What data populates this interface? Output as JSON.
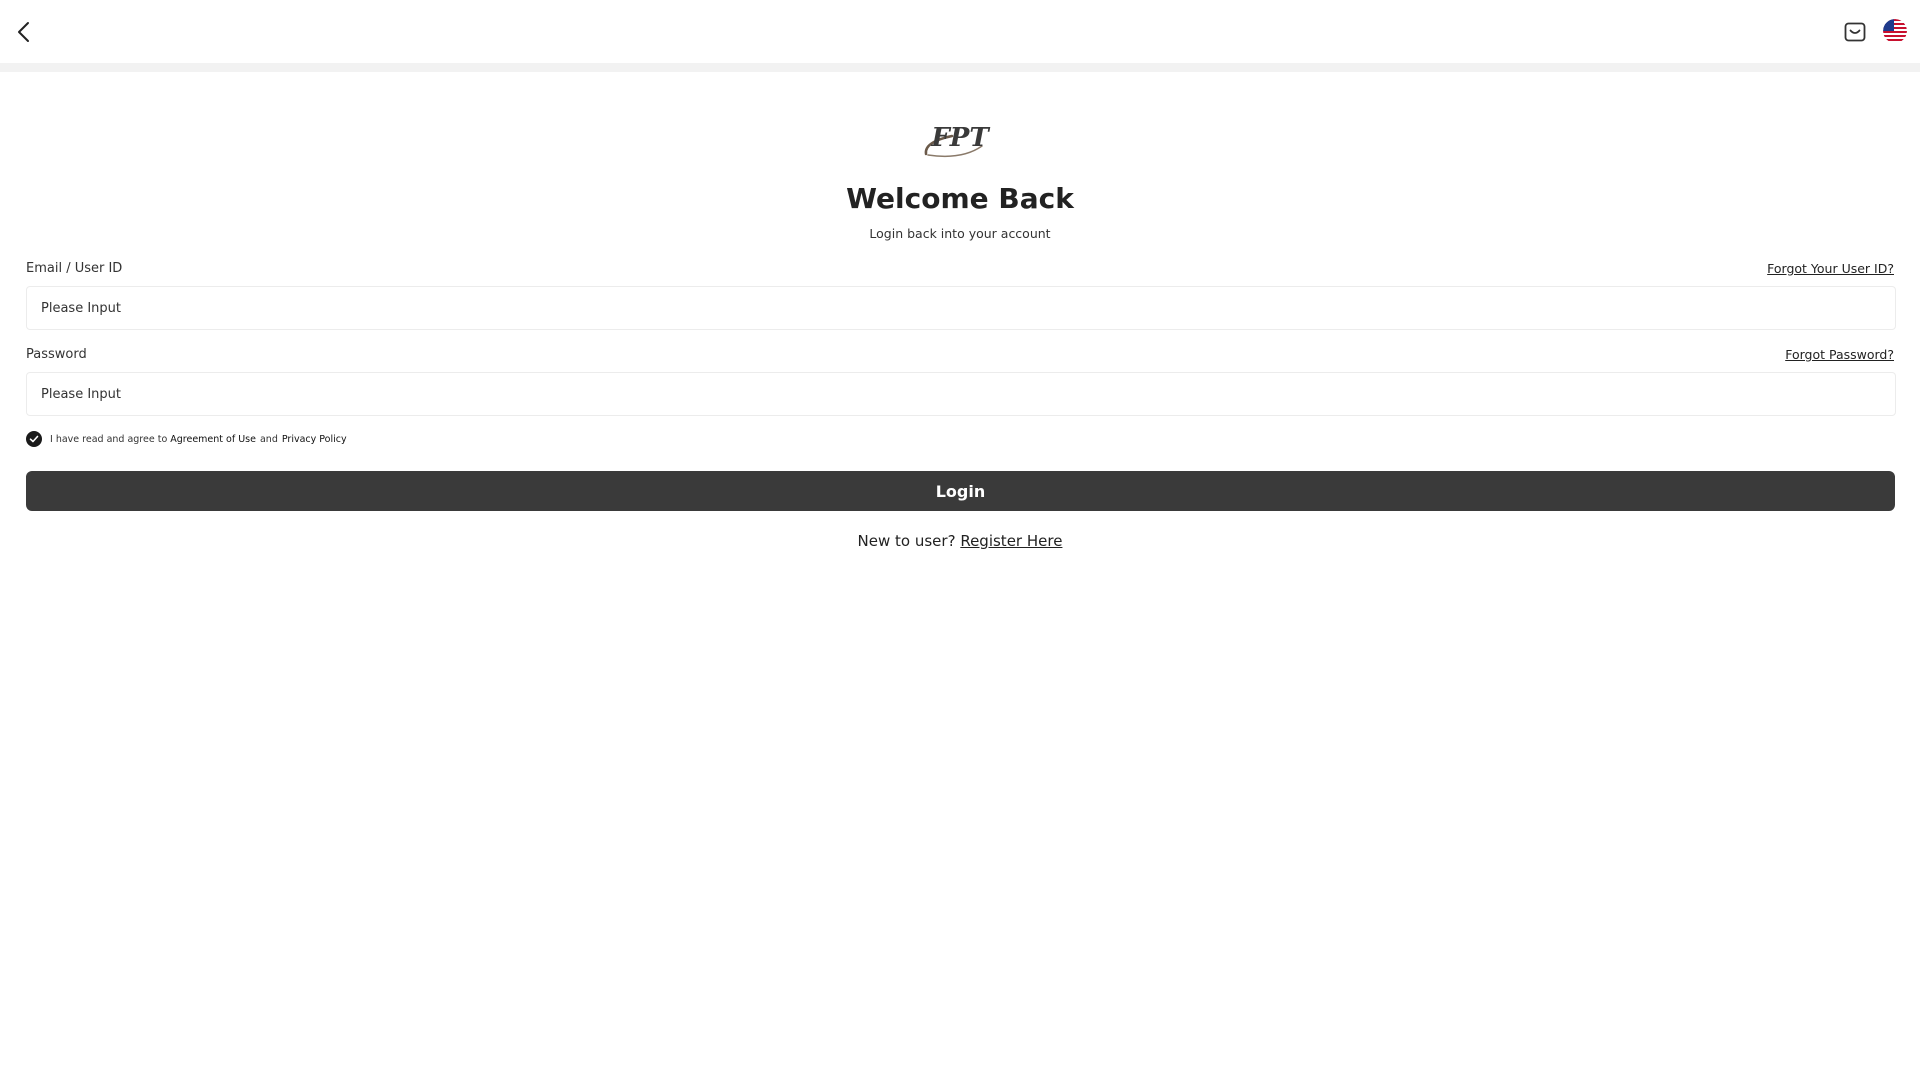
{
  "header": {
    "back_icon": "chevron-left-icon",
    "support_icon": "message-icon",
    "language_icon": "us-flag-icon"
  },
  "logo": {
    "text": "FPT"
  },
  "title": "Welcome Back",
  "subtitle": "Login back into your account",
  "email": {
    "label": "Email / User ID",
    "forgot_label": "Forgot Your User ID?",
    "placeholder": "Please Input",
    "value": ""
  },
  "password": {
    "label": "Password",
    "forgot_label": "Forgot Password?",
    "placeholder": "Please Input",
    "value": ""
  },
  "agreement": {
    "checked": true,
    "prefix": "I have read and agree to",
    "terms_label": "Agreement of Use",
    "and": "and",
    "privacy_label": "Privacy Policy"
  },
  "login_button": "Login",
  "register": {
    "prompt": "New to user?",
    "link_label": "Register Here"
  },
  "colors": {
    "primary_button": "#3a3a3a",
    "text": "#222222",
    "divider": "#f2f2f2"
  }
}
